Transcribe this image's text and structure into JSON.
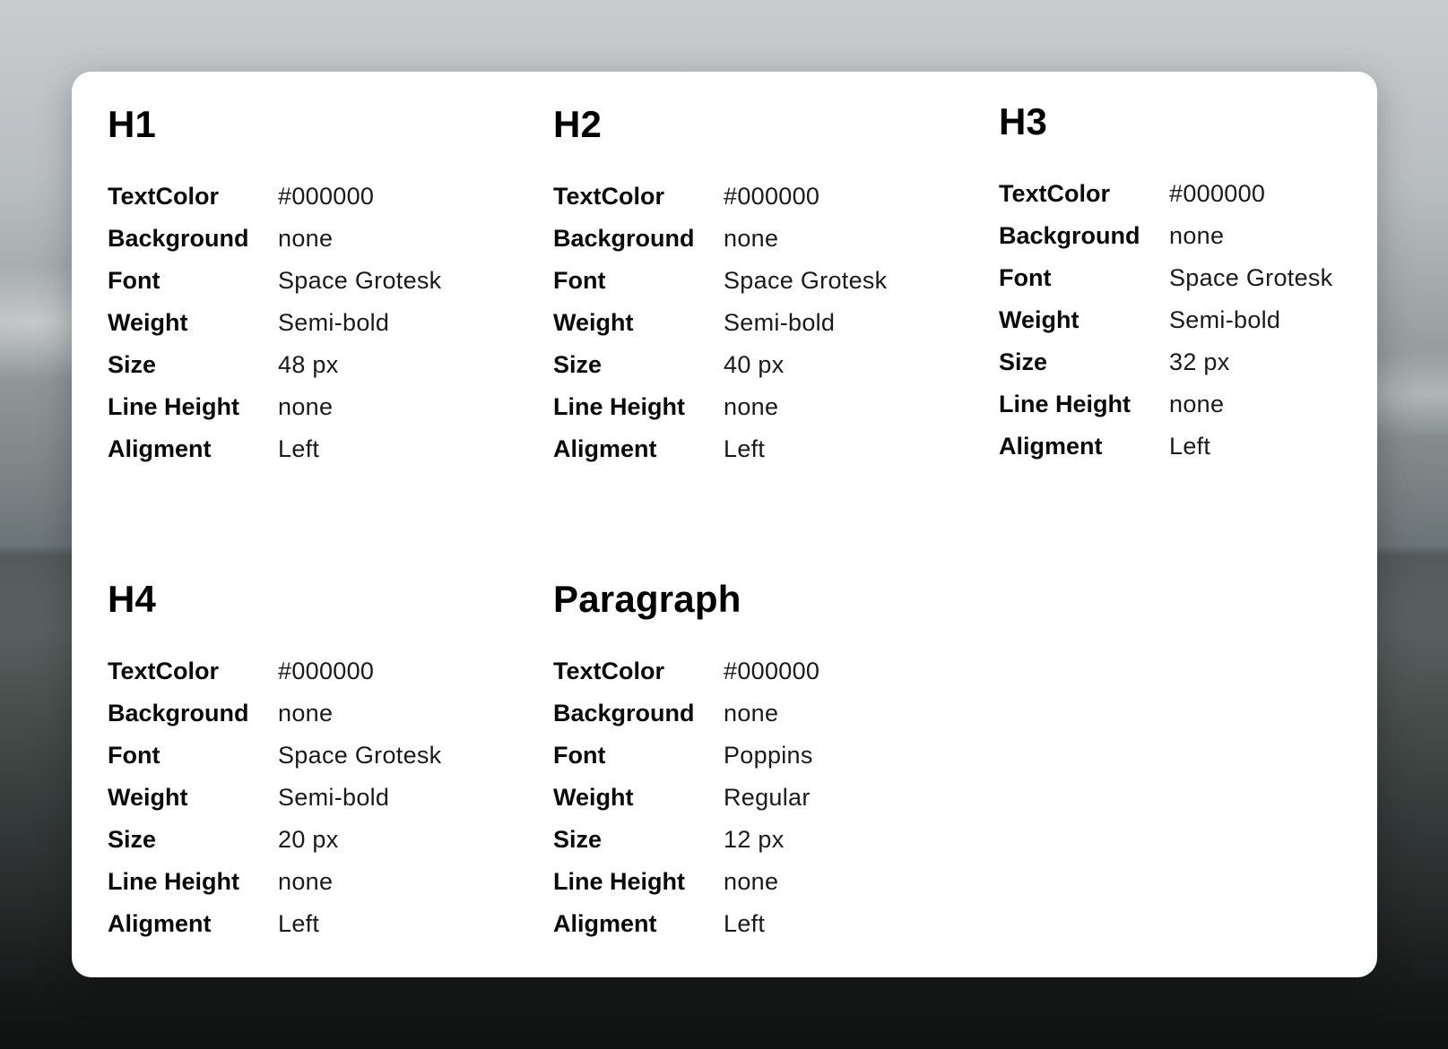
{
  "sections": [
    {
      "title": "H1",
      "rows": [
        {
          "label": "TextColor",
          "value": "#000000"
        },
        {
          "label": "Background",
          "value": "none"
        },
        {
          "label": "Font",
          "value": "Space Grotesk"
        },
        {
          "label": "Weight",
          "value": "Semi-bold"
        },
        {
          "label": "Size",
          "value": "48 px"
        },
        {
          "label": "Line Height",
          "value": "none"
        },
        {
          "label": "Aligment",
          "value": "Left"
        }
      ]
    },
    {
      "title": "H2",
      "rows": [
        {
          "label": "TextColor",
          "value": "#000000"
        },
        {
          "label": "Background",
          "value": "none"
        },
        {
          "label": "Font",
          "value": "Space Grotesk"
        },
        {
          "label": "Weight",
          "value": "Semi-bold"
        },
        {
          "label": "Size",
          "value": "40 px"
        },
        {
          "label": "Line Height",
          "value": "none"
        },
        {
          "label": "Aligment",
          "value": "Left"
        }
      ]
    },
    {
      "title": "H3",
      "rows": [
        {
          "label": "TextColor",
          "value": "#000000"
        },
        {
          "label": "Background",
          "value": "none"
        },
        {
          "label": "Font",
          "value": "Space Grotesk"
        },
        {
          "label": "Weight",
          "value": "Semi-bold"
        },
        {
          "label": "Size",
          "value": "32 px"
        },
        {
          "label": "Line Height",
          "value": "none"
        },
        {
          "label": "Aligment",
          "value": "Left"
        }
      ]
    },
    {
      "title": "H4",
      "rows": [
        {
          "label": "TextColor",
          "value": "#000000"
        },
        {
          "label": "Background",
          "value": "none"
        },
        {
          "label": "Font",
          "value": "Space Grotesk"
        },
        {
          "label": "Weight",
          "value": "Semi-bold"
        },
        {
          "label": "Size",
          "value": "20 px"
        },
        {
          "label": "Line Height",
          "value": "none"
        },
        {
          "label": "Aligment",
          "value": "Left"
        }
      ]
    },
    {
      "title": "Paragraph",
      "rows": [
        {
          "label": "TextColor",
          "value": "#000000"
        },
        {
          "label": "Background",
          "value": "none"
        },
        {
          "label": "Font",
          "value": "Poppins"
        },
        {
          "label": "Weight",
          "value": "Regular"
        },
        {
          "label": "Size",
          "value": "12 px"
        },
        {
          "label": "Line Height",
          "value": "none"
        },
        {
          "label": "Aligment",
          "value": "Left"
        }
      ]
    }
  ]
}
